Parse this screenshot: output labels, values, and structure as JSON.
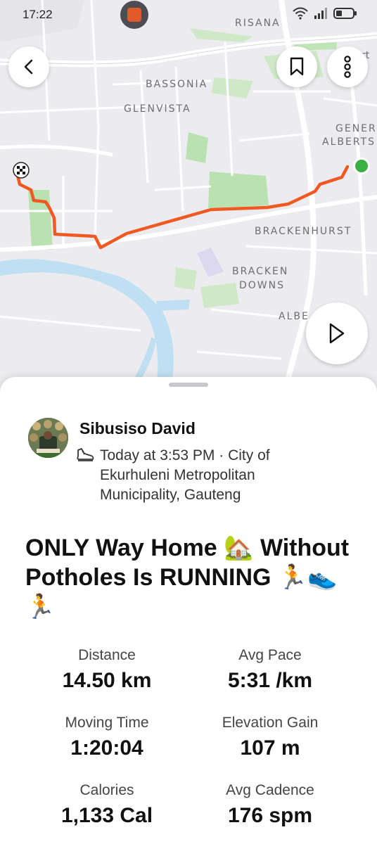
{
  "status_bar": {
    "time": "17:22",
    "icons": [
      "app-notification-icon",
      "wifi-icon",
      "signal-icon",
      "battery-icon"
    ]
  },
  "map": {
    "labels": {
      "risana": "RISANA",
      "bassonia": "BASSONIA",
      "glenvista": "GLENVISTA",
      "gener": "GENER",
      "alberts": "ALBERTS",
      "brackenhurst": "BRACKENHURST",
      "bracken": "BRACKEN",
      "downs": "DOWNS",
      "albe": "ALBE",
      "edge_rt": "rt"
    },
    "route_color": "#f05a22",
    "start_marker_color": "#3cb043",
    "buttons": [
      "back-icon",
      "bookmark-icon",
      "more-icon",
      "play-icon"
    ]
  },
  "activity": {
    "athlete_name": "Sibusiso David",
    "meta": "Today at 3:53 PM · City of Ekurhuleni Metropolitan Municipality, Gauteng",
    "title": "ONLY Way Home 🏡 Without Potholes Is RUNNING 🏃👟🏃",
    "activity_icon": "running-shoe-icon"
  },
  "stats": [
    {
      "label": "Distance",
      "value": "14.50 km"
    },
    {
      "label": "Avg Pace",
      "value": "5:31 /km"
    },
    {
      "label": "Moving Time",
      "value": "1:20:04"
    },
    {
      "label": "Elevation Gain",
      "value": "107 m"
    },
    {
      "label": "Calories",
      "value": "1,133 Cal"
    },
    {
      "label": "Avg Cadence",
      "value": "176 spm"
    }
  ]
}
